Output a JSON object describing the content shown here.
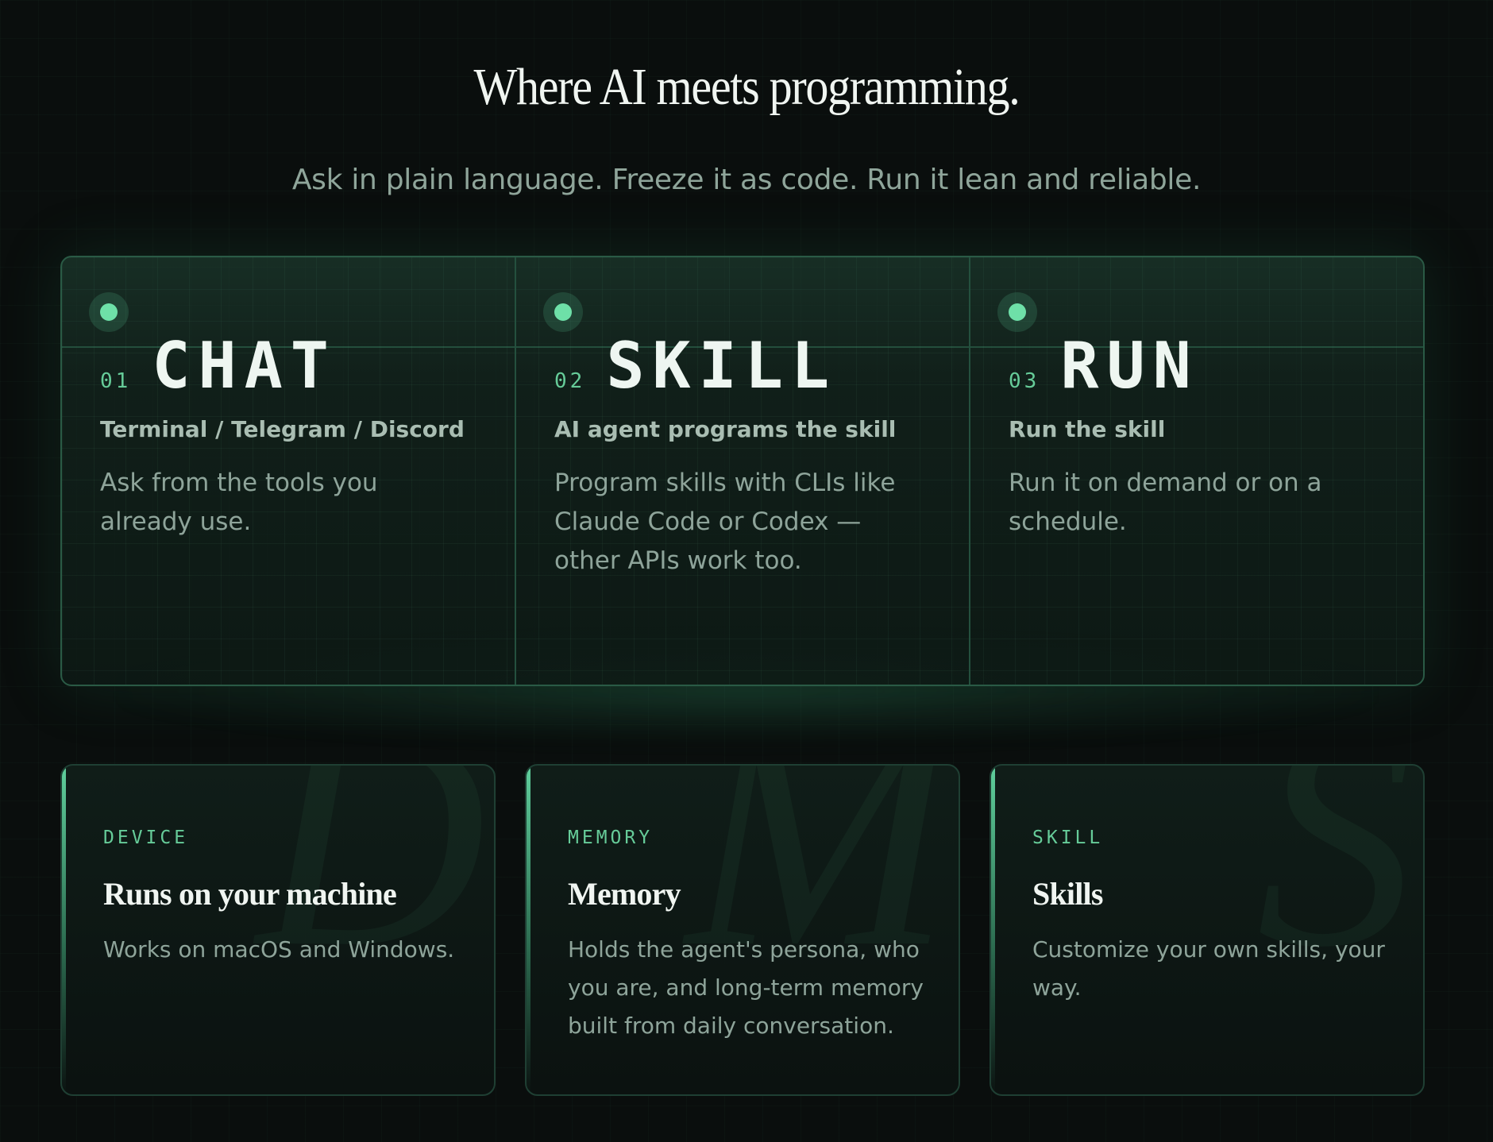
{
  "hero": {
    "title": "Where AI meets programming.",
    "subtitle": "Ask in plain language. Freeze it as code. Run it lean and reliable."
  },
  "steps": [
    {
      "number": "01",
      "name": "CHAT",
      "subtitle": "Terminal / Telegram / Discord",
      "description": "Ask from the tools you already use."
    },
    {
      "number": "02",
      "name": "SKILL",
      "subtitle": "AI agent programs the skill",
      "description": "Program skills with CLIs like Claude Code or Codex — other APIs work too."
    },
    {
      "number": "03",
      "name": "RUN",
      "subtitle": "Run the skill",
      "description": "Run it on demand or on a schedule."
    }
  ],
  "features": [
    {
      "tag": "DEVICE",
      "watermark": "D",
      "title": "Runs on your machine",
      "description": "Works on macOS and Windows."
    },
    {
      "tag": "MEMORY",
      "watermark": "M",
      "title": "Memory",
      "description": "Holds the agent's persona, who you are, and long-term memory built from daily conversation."
    },
    {
      "tag": "SKILL",
      "watermark": "S",
      "title": "Skills",
      "description": "Customize your own skills, your way."
    }
  ],
  "colors": {
    "background": "#0a0e0d",
    "accent": "#6ee0a8",
    "heading": "#f0f5f1",
    "muted": "#8ea49a"
  }
}
